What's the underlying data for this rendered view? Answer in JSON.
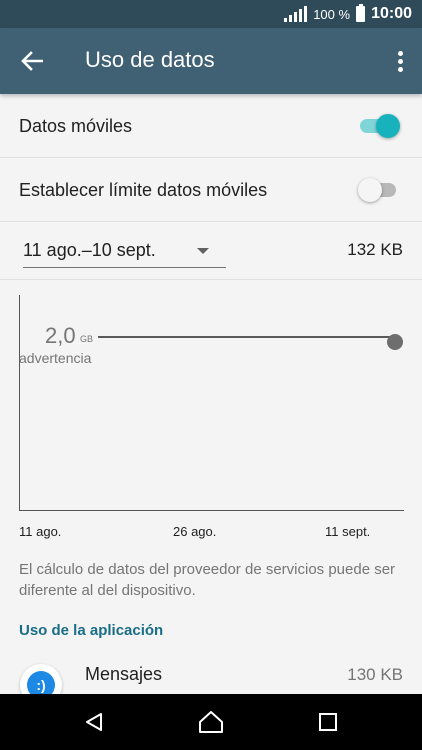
{
  "status_bar": {
    "battery_percent": "100 %",
    "time": "10:00",
    "icons": [
      "signal-icon",
      "battery-icon"
    ]
  },
  "app_bar": {
    "title": "Uso de datos",
    "icons": [
      "back-arrow-icon",
      "more-vert-icon"
    ]
  },
  "settings": {
    "mobile_data": {
      "label": "Datos móviles",
      "enabled": true
    },
    "mobile_limit": {
      "label": "Establecer límite datos móviles",
      "enabled": false
    }
  },
  "period": {
    "selected": "11 ago.–10 sept.",
    "total": "132 KB"
  },
  "chart": {
    "warning_value": "2,0",
    "warning_unit": "GB",
    "warning_label": "advertencia",
    "x_labels": [
      "11 ago.",
      "26 ago.",
      "11 sept."
    ]
  },
  "note": "El cálculo de datos del proveedor de servicios puede ser diferente al del dispositivo.",
  "app_usage": {
    "section_title": "Uso de la aplicación",
    "apps": [
      {
        "name": "Mensajes",
        "usage": "130 KB",
        "icon": "messages-icon"
      }
    ]
  },
  "nav_bar": {
    "icons": [
      "back-icon",
      "home-icon",
      "recents-icon"
    ]
  },
  "colors": {
    "status_bar": "#2f4b5a",
    "app_bar": "#3f6173",
    "accent_toggle": "#17b2bb",
    "section_header": "#1a6d86",
    "background": "#f4f4f4"
  }
}
